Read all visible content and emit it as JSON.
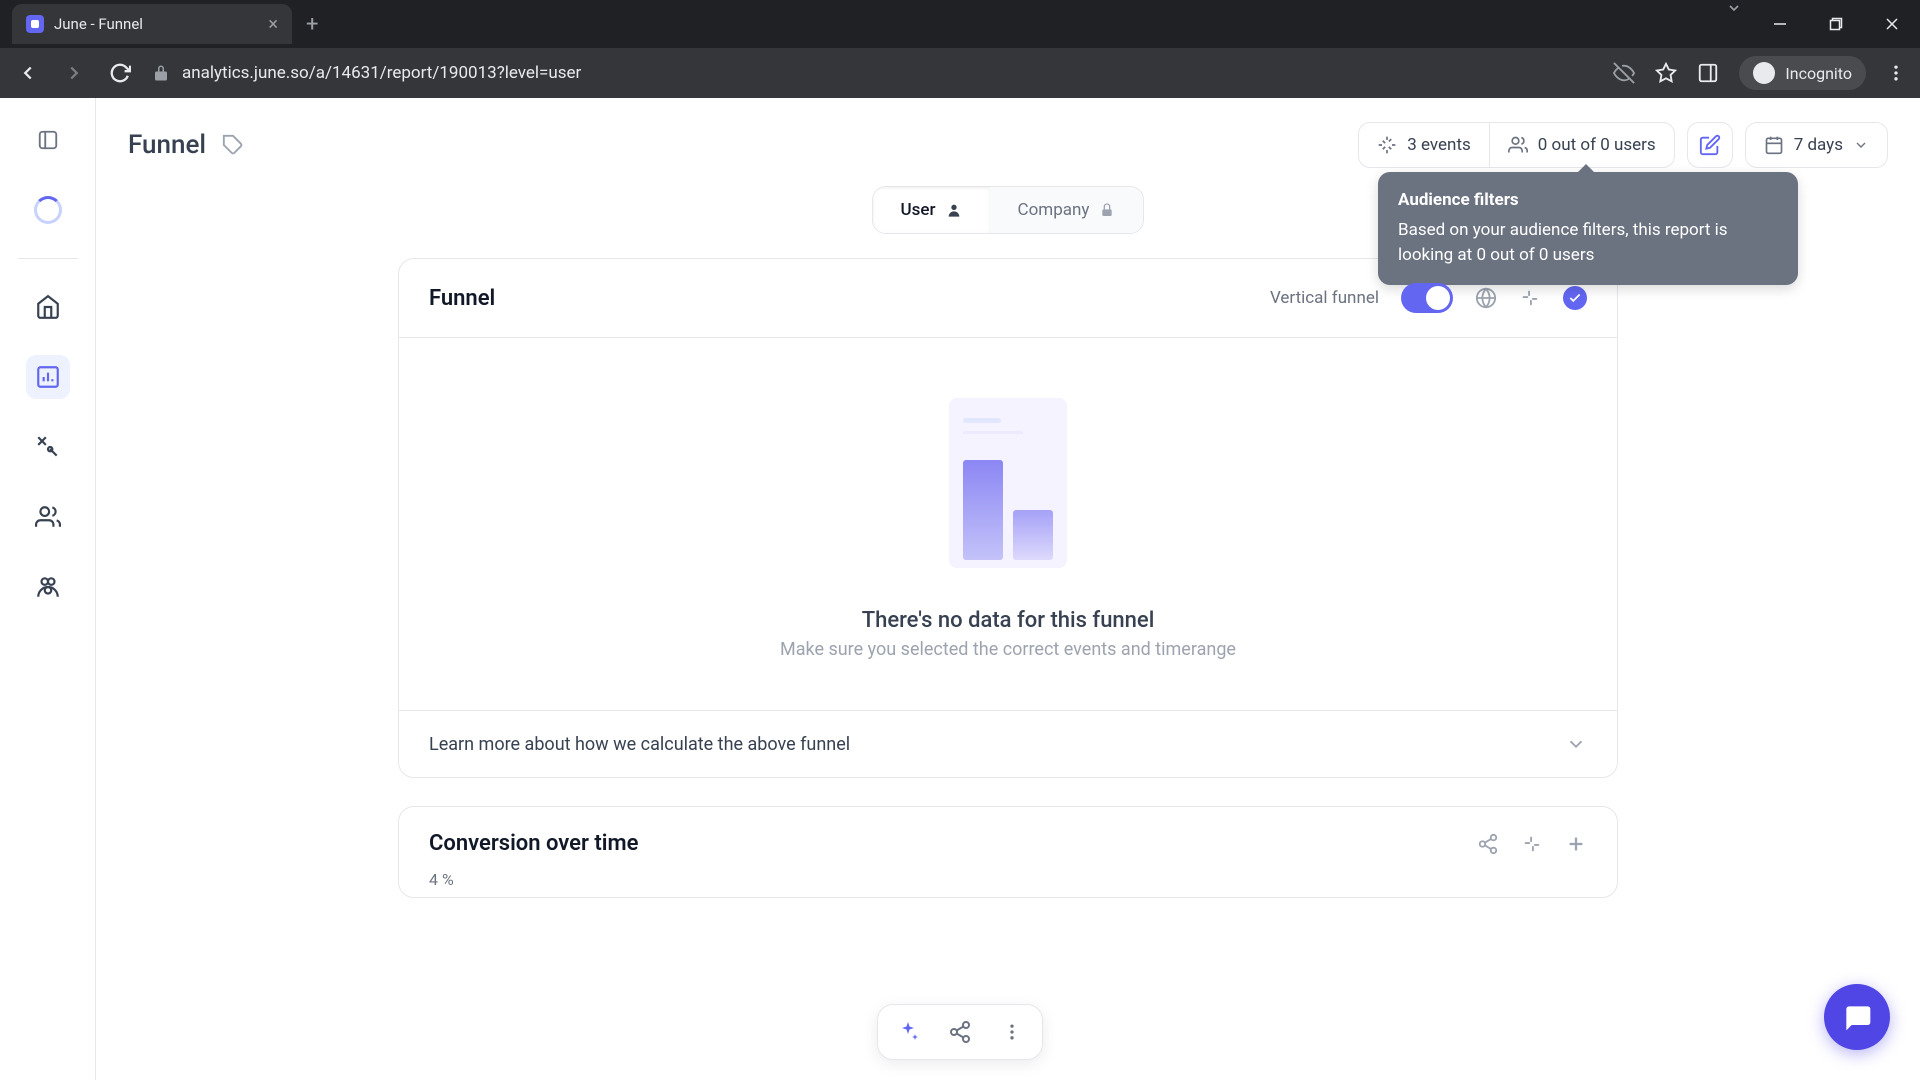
{
  "browser": {
    "tab_title": "June - Funnel",
    "url": "analytics.june.so/a/14631/report/190013?level=user",
    "incognito_label": "Incognito"
  },
  "header": {
    "page_title": "Funnel",
    "events_label": "3 events",
    "users_label": "0 out of 0 users",
    "date_range": "7 days"
  },
  "tooltip": {
    "title": "Audience filters",
    "body": "Based on your audience filters, this report is looking at 0 out of 0 users"
  },
  "level_switch": {
    "user": "User",
    "company": "Company"
  },
  "funnel_card": {
    "title": "Funnel",
    "vertical_label": "Vertical funnel",
    "empty_heading": "There's no data for this funnel",
    "empty_sub": "Make sure you selected the correct events and timerange",
    "learn_more": "Learn more about how we calculate the above funnel"
  },
  "conversion_card": {
    "title": "Conversion over time",
    "y_label": "4 %"
  }
}
